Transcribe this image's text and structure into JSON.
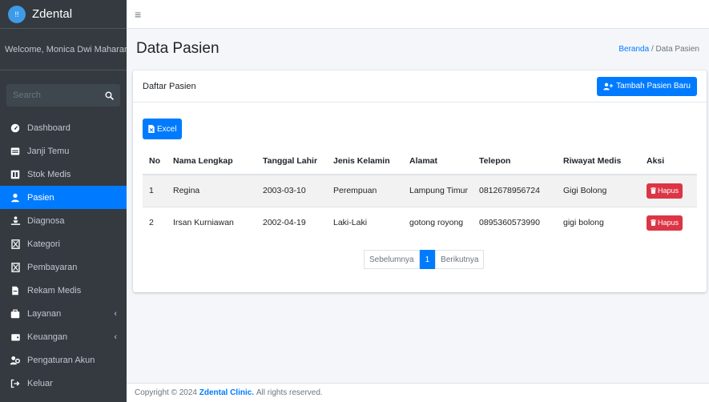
{
  "brand": {
    "logo_text": "!!",
    "name": "Zdental"
  },
  "user_panel": {
    "welcome": "Welcome, Monica Dwi Maharani"
  },
  "search": {
    "placeholder": "Search"
  },
  "sidebar": {
    "items": [
      {
        "label": "Dashboard",
        "icon": "tachometer-icon"
      },
      {
        "label": "Janji Temu",
        "icon": "calendar-icon"
      },
      {
        "label": "Stok Medis",
        "icon": "box-icon"
      },
      {
        "label": "Pasien",
        "icon": "user-icon",
        "active": true
      },
      {
        "label": "Diagnosa",
        "icon": "diagnoses-icon"
      },
      {
        "label": "Kategori",
        "icon": "tag-icon"
      },
      {
        "label": "Pembayaran",
        "icon": "money-icon"
      },
      {
        "label": "Rekam Medis",
        "icon": "file-icon"
      },
      {
        "label": "Layanan",
        "icon": "briefcase-icon",
        "chevron": true
      },
      {
        "label": "Keuangan",
        "icon": "wallet-icon",
        "chevron": true
      },
      {
        "label": "Pengaturan Akun",
        "icon": "users-icon"
      },
      {
        "label": "Keluar",
        "icon": "sign-out-icon"
      }
    ]
  },
  "header": {
    "title": "Data Pasien",
    "breadcrumb_home": "Beranda",
    "breadcrumb_sep": "/",
    "breadcrumb_current": "Data Pasien"
  },
  "card": {
    "title": "Daftar Pasien",
    "add_button": "Tambah Pasien Baru",
    "excel_button": "Excel"
  },
  "table": {
    "columns": [
      "No",
      "Nama Lengkap",
      "Tanggal Lahir",
      "Jenis Kelamin",
      "Alamat",
      "Telepon",
      "Riwayat Medis",
      "Aksi"
    ],
    "rows": [
      {
        "no": "1",
        "nama": "Regina",
        "tgl": "2003-03-10",
        "jk": "Perempuan",
        "alamat": "Lampung Timur",
        "telepon": "0812678956724",
        "riwayat": "Gigi Bolong",
        "aksi": "Hapus"
      },
      {
        "no": "2",
        "nama": "Irsan Kurniawan",
        "tgl": "2002-04-19",
        "jk": "Laki-Laki",
        "alamat": "gotong royong",
        "telepon": "0895360573990",
        "riwayat": "gigi bolong",
        "aksi": "Hapus"
      }
    ]
  },
  "pagination": {
    "prev": "Sebelumnya",
    "current": "1",
    "next": "Berikutnya"
  },
  "footer": {
    "prefix": "Copyright © 2024",
    "brand": "Zdental Clinic.",
    "suffix": "All rights reserved."
  },
  "colors": {
    "primary": "#007bff",
    "danger": "#dc3545",
    "sidebar_bg": "#343a40"
  }
}
